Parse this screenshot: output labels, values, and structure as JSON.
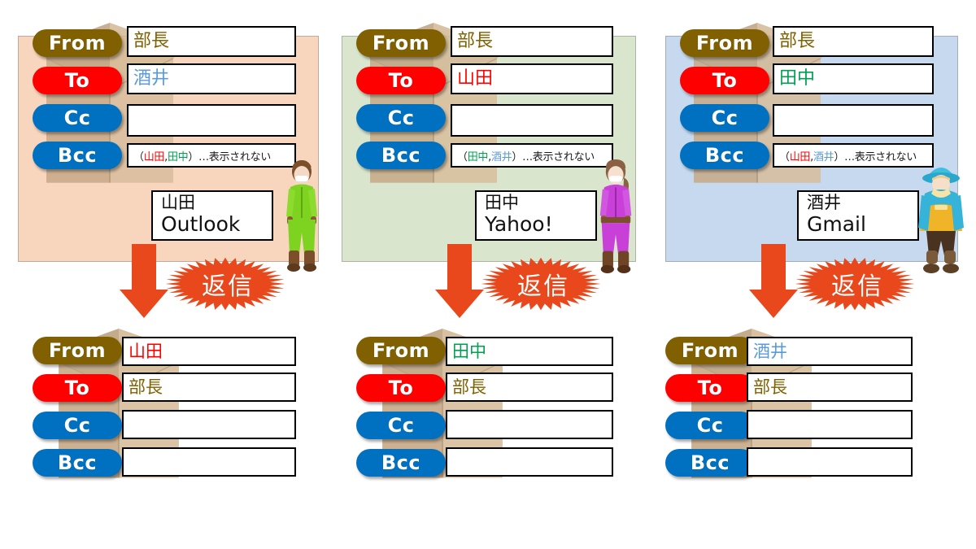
{
  "labels": {
    "from": "From",
    "to": "To",
    "cc": "Cc",
    "bcc": "Bcc",
    "reply": "返信"
  },
  "colors": {
    "from_pill": "#806000",
    "to_pill": "#FF0000",
    "cc_pill": "#0070C0",
    "bcc_pill": "#0070C0",
    "panel_1": "#F8D6BE",
    "panel_2": "#D9E6CD",
    "panel_3": "#C6D9EE",
    "name_bucho": "#806000",
    "name_yamada": "#FF0000",
    "name_tanaka": "#00A050",
    "name_sakai": "#5B9BD5",
    "arrow": "#E8481C",
    "burst": "#E8481C"
  },
  "sent": [
    {
      "id": "sent-1",
      "panel_color": "#F8D6BE",
      "from": {
        "value": "部長",
        "color": "#806000"
      },
      "to": {
        "value": "酒井",
        "color": "#5B9BD5"
      },
      "cc": {
        "value": ""
      },
      "bcc": {
        "open_paren": "（",
        "name1": "山田",
        "name1_color": "#FF0000",
        "comma": ",",
        "name2": "田中",
        "name2_color": "#00A050",
        "close_paren": "）",
        "note": "…表示されない"
      },
      "card": {
        "name": "山田",
        "service": "Outlook"
      },
      "avatar": "green-tracksuit-avatar"
    },
    {
      "id": "sent-2",
      "panel_color": "#D9E6CD",
      "from": {
        "value": "部長",
        "color": "#806000"
      },
      "to": {
        "value": "山田",
        "color": "#FF0000"
      },
      "cc": {
        "value": ""
      },
      "bcc": {
        "open_paren": "（",
        "name1": "田中",
        "name1_color": "#00A050",
        "comma": ",",
        "name2": "酒井",
        "name2_color": "#5B9BD5",
        "close_paren": "）",
        "note": "…表示されない"
      },
      "card": {
        "name": "田中",
        "service": "Yahoo!"
      },
      "avatar": "purple-tracksuit-avatar"
    },
    {
      "id": "sent-3",
      "panel_color": "#C6D9EE",
      "from": {
        "value": "部長",
        "color": "#806000"
      },
      "to": {
        "value": "田中",
        "color": "#00A050"
      },
      "cc": {
        "value": ""
      },
      "bcc": {
        "open_paren": "（",
        "name1": "山田",
        "name1_color": "#FF0000",
        "comma": ",",
        "name2": "酒井",
        "name2_color": "#5B9BD5",
        "close_paren": "）",
        "note": "…表示されない"
      },
      "card": {
        "name": "酒井",
        "service": "Gmail"
      },
      "avatar": "blue-mage-avatar"
    }
  ],
  "replies": [
    {
      "id": "reply-1",
      "from": {
        "value": "山田",
        "color": "#FF0000"
      },
      "to": {
        "value": "部長",
        "color": "#806000"
      },
      "cc": {
        "value": ""
      },
      "bcc": {
        "value": ""
      }
    },
    {
      "id": "reply-2",
      "from": {
        "value": "田中",
        "color": "#00A050"
      },
      "to": {
        "value": "部長",
        "color": "#806000"
      },
      "cc": {
        "value": ""
      },
      "bcc": {
        "value": ""
      }
    },
    {
      "id": "reply-3",
      "from": {
        "value": "酒井",
        "color": "#5B9BD5"
      },
      "to": {
        "value": "部長",
        "color": "#806000"
      },
      "cc": {
        "value": ""
      },
      "bcc": {
        "value": ""
      }
    }
  ]
}
